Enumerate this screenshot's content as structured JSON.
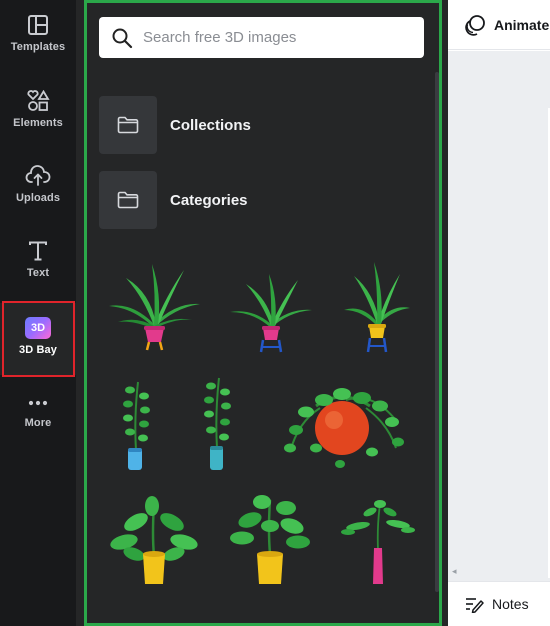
{
  "sidebar": {
    "items": [
      {
        "label": "Templates",
        "icon": "templates-icon"
      },
      {
        "label": "Elements",
        "icon": "elements-icon"
      },
      {
        "label": "Uploads",
        "icon": "upload-cloud-icon"
      },
      {
        "label": "Text",
        "icon": "text-t-icon"
      },
      {
        "label": "3D Bay",
        "icon": "3d-bay-icon",
        "badge": "3D",
        "active": true
      },
      {
        "label": "More",
        "icon": "more-dots-icon"
      }
    ],
    "active_highlight_color": "#e0242b"
  },
  "panel": {
    "highlight_color": "#2ba84a",
    "search": {
      "placeholder": "Search free 3D images"
    },
    "folders": [
      {
        "label": "Collections",
        "icon": "folder-icon"
      },
      {
        "label": "Categories",
        "icon": "folder-icon"
      }
    ],
    "grid_items": [
      {
        "name": "3d-plant-tropical-pink-pot"
      },
      {
        "name": "3d-plant-spider-blue-stand"
      },
      {
        "name": "3d-plant-palm-yellow-stand"
      },
      {
        "name": "3d-plant-zz-blue-vase"
      },
      {
        "name": "3d-plant-zz-teal-vase"
      },
      {
        "name": "3d-plant-pothos-orange-pot"
      },
      {
        "name": "3d-plant-fiddle-yellow-pot"
      },
      {
        "name": "3d-plant-rubber-yellow-pot"
      },
      {
        "name": "3d-plant-sprig-pink-vase"
      }
    ]
  },
  "header": {
    "animate_label": "Animate"
  },
  "footer": {
    "notes_label": "Notes"
  }
}
